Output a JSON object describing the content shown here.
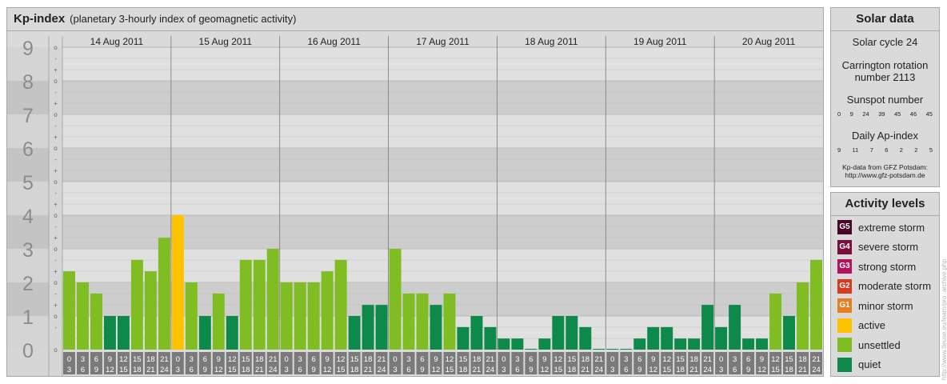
{
  "header": {
    "title": "Kp-index",
    "subtitle": "(planetary 3-hourly index of geomagnetic activity)"
  },
  "chart_data": {
    "type": "bar",
    "days": [
      "14 Aug 2011",
      "15 Aug 2011",
      "16 Aug 2011",
      "17 Aug 2011",
      "18 Aug 2011",
      "19 Aug 2011",
      "20 Aug 2011"
    ],
    "interval_starts": [
      "0",
      "3",
      "6",
      "9",
      "12",
      "15",
      "18",
      "21"
    ],
    "interval_ends": [
      "3",
      "6",
      "9",
      "12",
      "15",
      "18",
      "21",
      "24"
    ],
    "values": [
      2.33,
      2.0,
      1.67,
      1.0,
      1.0,
      2.67,
      2.33,
      3.33,
      4.0,
      2.0,
      1.0,
      1.67,
      1.0,
      2.67,
      2.67,
      3.0,
      2.0,
      2.0,
      2.0,
      2.33,
      2.67,
      1.0,
      1.33,
      1.33,
      3.0,
      1.67,
      1.67,
      1.33,
      1.67,
      0.67,
      1.0,
      0.67,
      0.33,
      0.33,
      0.0,
      0.33,
      1.0,
      1.0,
      0.67,
      0.0,
      0.0,
      0.0,
      0.33,
      0.67,
      0.67,
      0.33,
      0.33,
      1.33,
      0.67,
      1.33,
      0.33,
      0.33,
      1.67,
      1.0,
      2.0,
      2.67
    ],
    "ylim": [
      0,
      9
    ],
    "y_ticks": [
      "0",
      "1",
      "2",
      "3",
      "4",
      "5",
      "6",
      "7",
      "8",
      "9"
    ],
    "minor_ticks": [
      "+",
      "o",
      "-"
    ],
    "colors": {
      "quiet": "#0d8a4a",
      "unsettled": "#7fbd22",
      "active": "#fec200",
      "minor_storm": "#e87d1e",
      "moderate_storm": "#d9391c",
      "strong_storm": "#b3135c",
      "severe_storm": "#7a0e3c",
      "extreme_storm": "#4a0626"
    }
  },
  "solar": {
    "title": "Solar data",
    "cycle": "Solar cycle 24",
    "carrington": "Carrington rotation number 2113",
    "sunspot_label": "Sunspot number",
    "sunspot_values": [
      "0",
      "9",
      "24",
      "39",
      "45",
      "46",
      "45"
    ],
    "ap_label": "Daily Ap-index",
    "ap_values": [
      "9",
      "11",
      "7",
      "6",
      "2",
      "2",
      "5"
    ],
    "credit_line1": "Kp-data from GFZ Potsdam:",
    "credit_line2": "http://www.gfz-potsdam.de"
  },
  "levels": {
    "title": "Activity levels",
    "items": [
      {
        "badge": "G5",
        "label": "extreme storm",
        "color": "#4a0626"
      },
      {
        "badge": "G4",
        "label": "severe storm",
        "color": "#7a0e3c"
      },
      {
        "badge": "G3",
        "label": "strong storm",
        "color": "#b3135c"
      },
      {
        "badge": "G2",
        "label": "moderate storm",
        "color": "#d9391c"
      },
      {
        "badge": "G1",
        "label": "minor storm",
        "color": "#e87d1e"
      },
      {
        "badge": "",
        "label": "active",
        "color": "#fec200"
      },
      {
        "badge": "",
        "label": "unsettled",
        "color": "#7fbd22"
      },
      {
        "badge": "",
        "label": "quiet",
        "color": "#0d8a4a"
      }
    ]
  },
  "side_note": "http://www.tleuse.eu/learn/pro_archive.php"
}
